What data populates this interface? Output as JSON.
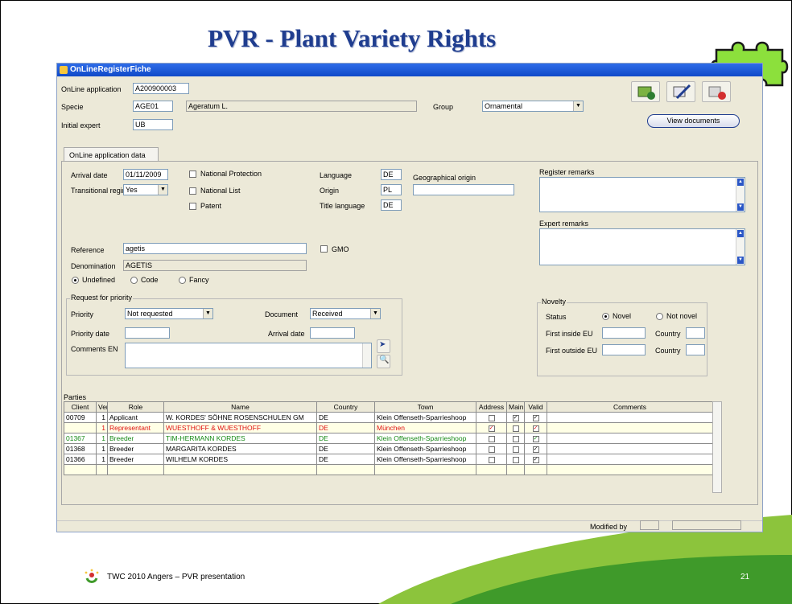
{
  "slide": {
    "title": "PVR - Plant Variety Rights",
    "footer": "TWC 2010 Angers – PVR presentation",
    "page_number": "21"
  },
  "window": {
    "title": "OnLineRegisterFiche",
    "view_documents_label": "View documents",
    "tab_label": "OnLine application data",
    "modified_by_label": "Modified by"
  },
  "header": {
    "online_application_label": "OnLine application",
    "online_application_value": "A200900003",
    "specie_label": "Specie",
    "specie_code": "AGE01",
    "specie_name": "Ageratum L.",
    "group_label": "Group",
    "group_value": "Ornamental",
    "initial_expert_label": "Initial expert",
    "initial_expert_value": "UB"
  },
  "app": {
    "arrival_date_label": "Arrival date",
    "arrival_date_value": "01/11/2009",
    "transitional_regime_label": "Transitional regime",
    "transitional_regime_value": "Yes",
    "national_protection_label": "National Protection",
    "national_list_label": "National List",
    "patent_label": "Patent",
    "language_label": "Language",
    "language_value": "DE",
    "origin_label": "Origin",
    "origin_value": "PL",
    "title_language_label": "Title language",
    "title_language_value": "DE",
    "geographical_origin_label": "Geographical origin",
    "register_remarks_label": "Register remarks",
    "expert_remarks_label": "Expert remarks",
    "reference_label": "Reference",
    "reference_value": "agetis",
    "gmo_label": "GMO",
    "denomination_label": "Denomination",
    "denomination_value": "AGETIS",
    "denom_undefined": "Undefined",
    "denom_code": "Code",
    "denom_fancy": "Fancy"
  },
  "priority": {
    "group_label": "Request for priority",
    "priority_label": "Priority",
    "priority_value": "Not requested",
    "document_label": "Document",
    "document_value": "Received",
    "priority_date_label": "Priority date",
    "arrival_date_label": "Arrival date",
    "comments_label": "Comments EN"
  },
  "novelty": {
    "group_label": "Novelty",
    "status_label": "Status",
    "novel_label": "Novel",
    "not_novel_label": "Not novel",
    "first_inside_label": "First inside EU",
    "first_outside_label": "First outside EU",
    "country_label": "Country"
  },
  "parties": {
    "label": "Parties",
    "columns": [
      "Client",
      "Vers",
      "Role",
      "Name",
      "Country",
      "Town",
      "Address",
      "Main",
      "Valid",
      "Comments"
    ],
    "rows": [
      {
        "client": "00709",
        "vers": "1",
        "role": "Applicant",
        "name": "W. KORDES' SÖHNE ROSENSCHULEN GM",
        "country": "DE",
        "town": "Klein Offenseth-Sparrieshoop",
        "address": false,
        "main": true,
        "valid": true,
        "comments": "",
        "style": "normal"
      },
      {
        "client": "",
        "vers": "1",
        "role": "Representant",
        "name": "WUESTHOFF & WUESTHOFF",
        "country": "DE",
        "town": "München",
        "address": true,
        "main": false,
        "valid": true,
        "comments": "",
        "style": "red"
      },
      {
        "client": "01367",
        "vers": "1",
        "role": "Breeder",
        "name": "TIM-HERMANN KORDES",
        "country": "DE",
        "town": "Klein Offenseth-Sparrieshoop",
        "address": false,
        "main": false,
        "valid": true,
        "comments": "",
        "style": "green"
      },
      {
        "client": "01368",
        "vers": "1",
        "role": "Breeder",
        "name": "MARGARITA KORDES",
        "country": "DE",
        "town": "Klein Offenseth-Sparrieshoop",
        "address": false,
        "main": false,
        "valid": true,
        "comments": "",
        "style": "normal"
      },
      {
        "client": "01366",
        "vers": "1",
        "role": "Breeder",
        "name": "WILHELM KORDES",
        "country": "DE",
        "town": "Klein Offenseth-Sparrieshoop",
        "address": false,
        "main": false,
        "valid": true,
        "comments": "",
        "style": "normal"
      }
    ]
  },
  "colors": {
    "title": "#1f3d8f",
    "titlebar": "#0f49c8",
    "swoosh_light": "#8cc43c",
    "swoosh_dark": "#3f9a2a",
    "puzzle": "#8ce03c"
  },
  "icons": [
    "validate-icon",
    "edit-icon",
    "delete-icon",
    "search-icon",
    "pick-icon",
    "puzzle-icon"
  ]
}
